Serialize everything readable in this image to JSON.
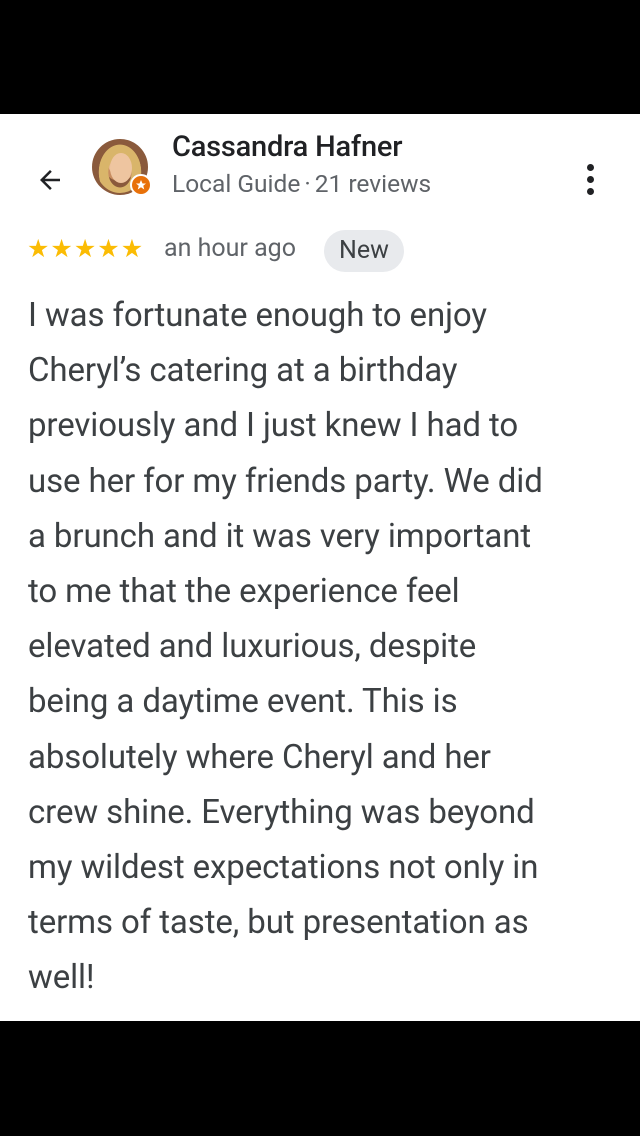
{
  "reviewer": {
    "name": "Cassandra Hafner",
    "level": "Local Guide",
    "separator": "·",
    "reviews_count": "21 reviews",
    "avatar_icon": "user-photo",
    "badge_color": "#e8710a"
  },
  "review": {
    "rating": 5,
    "max_rating": 5,
    "star_glyph": "★",
    "star_color": "#fbbc04",
    "time": "an hour ago",
    "badge": "New",
    "lines": [
      "I was fortunate enough to enjoy",
      "Cheryl’s catering at a birthday",
      "previously and I just knew I had to",
      "use her for my friends party. We did",
      "a brunch and it was very important",
      "to me that the experience feel",
      "elevated and luxurious, despite",
      "being a daytime event. This is",
      "absolutely where Cheryl and her",
      "crew shine. Everything was beyond",
      "my wildest expectations not only in",
      "terms of taste, but presentation as",
      "well!"
    ]
  },
  "icons": {
    "back": "arrow-left-icon",
    "more": "more-vert-icon"
  }
}
